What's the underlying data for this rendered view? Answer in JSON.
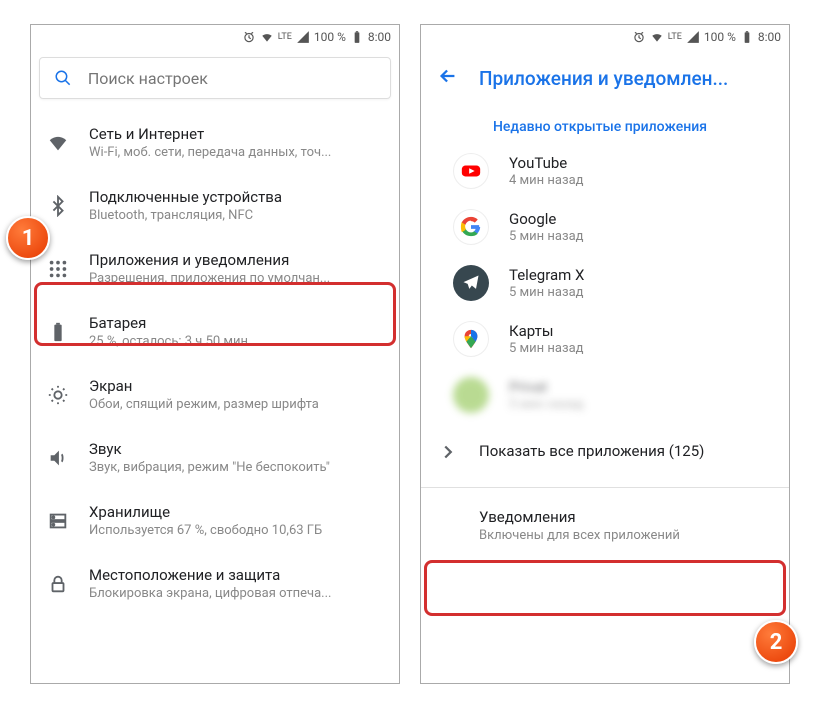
{
  "statusbar": {
    "battery": "100 %",
    "time": "8:00",
    "net": "LTE"
  },
  "screen1": {
    "search_placeholder": "Поиск настроек",
    "items": [
      {
        "title": "Сеть и Интернет",
        "subtitle": "Wi-Fi, моб. сети, передача данных, точ..."
      },
      {
        "title": "Подключенные устройства",
        "subtitle": "Bluetooth, трансляция, NFC"
      },
      {
        "title": "Приложения и уведомления",
        "subtitle": "Разрешения, приложения по умолчан..."
      },
      {
        "title": "Батарея",
        "subtitle": "25 %, осталось: 3 ч 50 мин"
      },
      {
        "title": "Экран",
        "subtitle": "Обои, спящий режим, размер шрифта"
      },
      {
        "title": "Звук",
        "subtitle": "Звук, вибрация, режим \"Не беспокоить\""
      },
      {
        "title": "Хранилище",
        "subtitle": "Используется 67 %, свободно 10,63 ГБ"
      },
      {
        "title": "Местоположение и защита",
        "subtitle": "Блокировка экрана, цифровая отпеча..."
      }
    ]
  },
  "screen2": {
    "header": "Приложения и уведомлен...",
    "section": "Недавно открытые приложения",
    "apps": [
      {
        "title": "YouTube",
        "subtitle": "4 мин назад"
      },
      {
        "title": "Google",
        "subtitle": "5 мин назад"
      },
      {
        "title": "Telegram X",
        "subtitle": "5 мин назад"
      },
      {
        "title": "Карты",
        "subtitle": "5 мин назад"
      },
      {
        "title": "Privat",
        "subtitle": "5 мин назад"
      }
    ],
    "show_all": "Показать все приложения (125)",
    "notifications": {
      "title": "Уведомления",
      "subtitle": "Включены для всех приложений"
    }
  },
  "callouts": {
    "one": "1",
    "two": "2"
  }
}
